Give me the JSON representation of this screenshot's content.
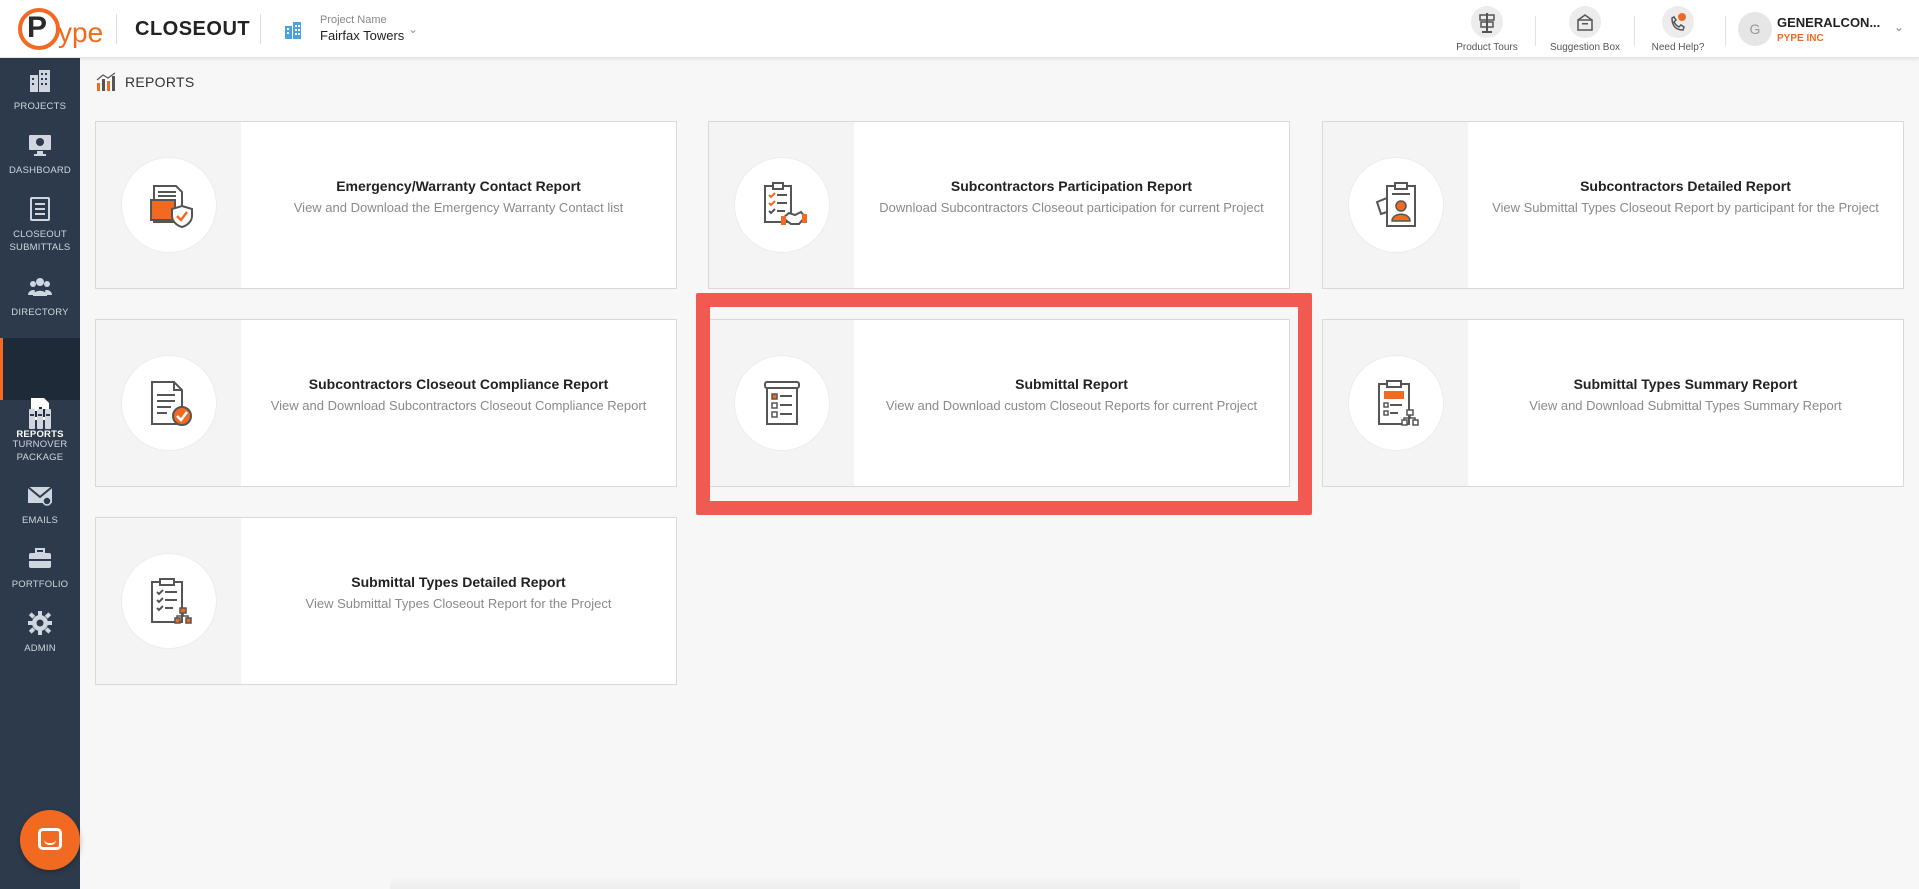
{
  "header": {
    "logo": {
      "p": "P",
      "ype": "ype"
    },
    "app_title": "CLOSEOUT",
    "project_label": "Project Name",
    "project_name": "Fairfax Towers",
    "tools": [
      {
        "label": "Product Tours",
        "icon": "signpost-icon"
      },
      {
        "label": "Suggestion Box",
        "icon": "suggestion-box-icon"
      },
      {
        "label": "Need Help?",
        "icon": "phone-help-icon"
      }
    ],
    "user": {
      "initial": "G",
      "name": "GENERALCON...",
      "org": "PYPE INC"
    }
  },
  "sidebar": {
    "items": [
      {
        "label": "PROJECTS",
        "icon": "building-icon"
      },
      {
        "label": "DASHBOARD",
        "icon": "monitor-icon"
      },
      {
        "label": "CLOSEOUT\nSUBMITTALS",
        "icon": "document-list-icon"
      },
      {
        "label": "DIRECTORY",
        "icon": "people-icon"
      },
      {
        "label": "REPORTS",
        "icon": "report-chart-icon",
        "active": true
      },
      {
        "label": "TURNOVER\nPACKAGE",
        "icon": "binders-icon"
      },
      {
        "label": "EMAILS",
        "icon": "envelope-icon"
      },
      {
        "label": "PORTFOLIO",
        "icon": "briefcase-icon"
      },
      {
        "label": "ADMIN",
        "icon": "gear-icon"
      }
    ]
  },
  "breadcrumb": {
    "label": "REPORTS",
    "icon": "report-chart-icon"
  },
  "cards": [
    {
      "title": "Emergency/Warranty Contact Report",
      "description": "View and Download the Emergency Warranty Contact list",
      "icon": "warranty-shield-icon"
    },
    {
      "title": "Subcontractors Participation Report",
      "description": "Download Subcontractors Closeout participation for current Project",
      "icon": "checklist-handshake-icon"
    },
    {
      "title": "Subcontractors Detailed Report",
      "description": "View Submittal Types Closeout Report by participant for the Project",
      "icon": "clipboard-person-icon"
    },
    {
      "title": "Subcontractors Closeout Compliance Report",
      "description": "View and Download Subcontractors Closeout Compliance Report",
      "icon": "document-check-icon"
    },
    {
      "title": "Submittal Report",
      "description": "View and Download custom Closeout Reports for current Project",
      "icon": "scroll-checklist-icon"
    },
    {
      "title": "Submittal Types Summary Report",
      "description": "View and Download Submittal Types Summary Report",
      "icon": "clipboard-hierarchy-icon"
    },
    {
      "title": "Submittal Types Detailed Report",
      "description": "View Submittal Types Closeout Report for the Project",
      "icon": "clipboard-tree-icon"
    }
  ],
  "colors": {
    "accent": "#f26a21",
    "sidebar": "#2d3a4b",
    "highlight": "#f05a50"
  }
}
